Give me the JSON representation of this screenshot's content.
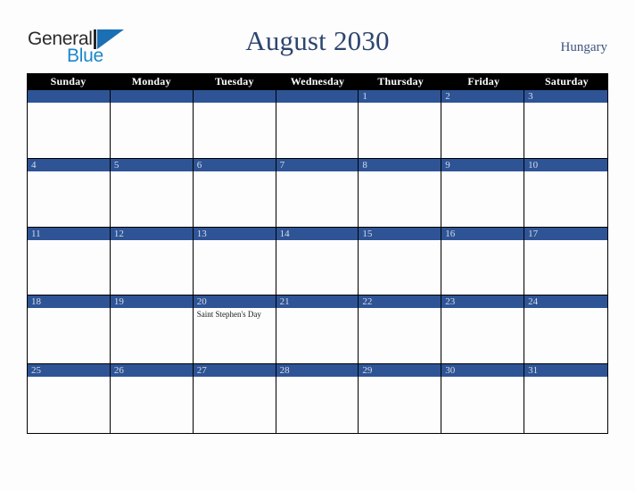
{
  "logo": {
    "word1": "General",
    "word2": "Blue",
    "triangle_color": "#1b6fb5",
    "word2_color": "#1b87c9"
  },
  "header": {
    "title": "August 2030",
    "country": "Hungary",
    "title_color": "#2e456e"
  },
  "calendar": {
    "weekdays": [
      "Sunday",
      "Monday",
      "Tuesday",
      "Wednesday",
      "Thursday",
      "Friday",
      "Saturday"
    ],
    "band_color": "#2e5496",
    "header_bg": "#000000",
    "weeks": [
      [
        {
          "number": ""
        },
        {
          "number": ""
        },
        {
          "number": ""
        },
        {
          "number": ""
        },
        {
          "number": "1"
        },
        {
          "number": "2"
        },
        {
          "number": "3"
        }
      ],
      [
        {
          "number": "4"
        },
        {
          "number": "5"
        },
        {
          "number": "6"
        },
        {
          "number": "7"
        },
        {
          "number": "8"
        },
        {
          "number": "9"
        },
        {
          "number": "10"
        }
      ],
      [
        {
          "number": "11"
        },
        {
          "number": "12"
        },
        {
          "number": "13"
        },
        {
          "number": "14"
        },
        {
          "number": "15"
        },
        {
          "number": "16"
        },
        {
          "number": "17"
        }
      ],
      [
        {
          "number": "18"
        },
        {
          "number": "19"
        },
        {
          "number": "20",
          "events": [
            "Saint Stephen's Day"
          ]
        },
        {
          "number": "21"
        },
        {
          "number": "22"
        },
        {
          "number": "23"
        },
        {
          "number": "24"
        }
      ],
      [
        {
          "number": "25"
        },
        {
          "number": "26"
        },
        {
          "number": "27"
        },
        {
          "number": "28"
        },
        {
          "number": "29"
        },
        {
          "number": "30"
        },
        {
          "number": "31"
        }
      ]
    ]
  }
}
